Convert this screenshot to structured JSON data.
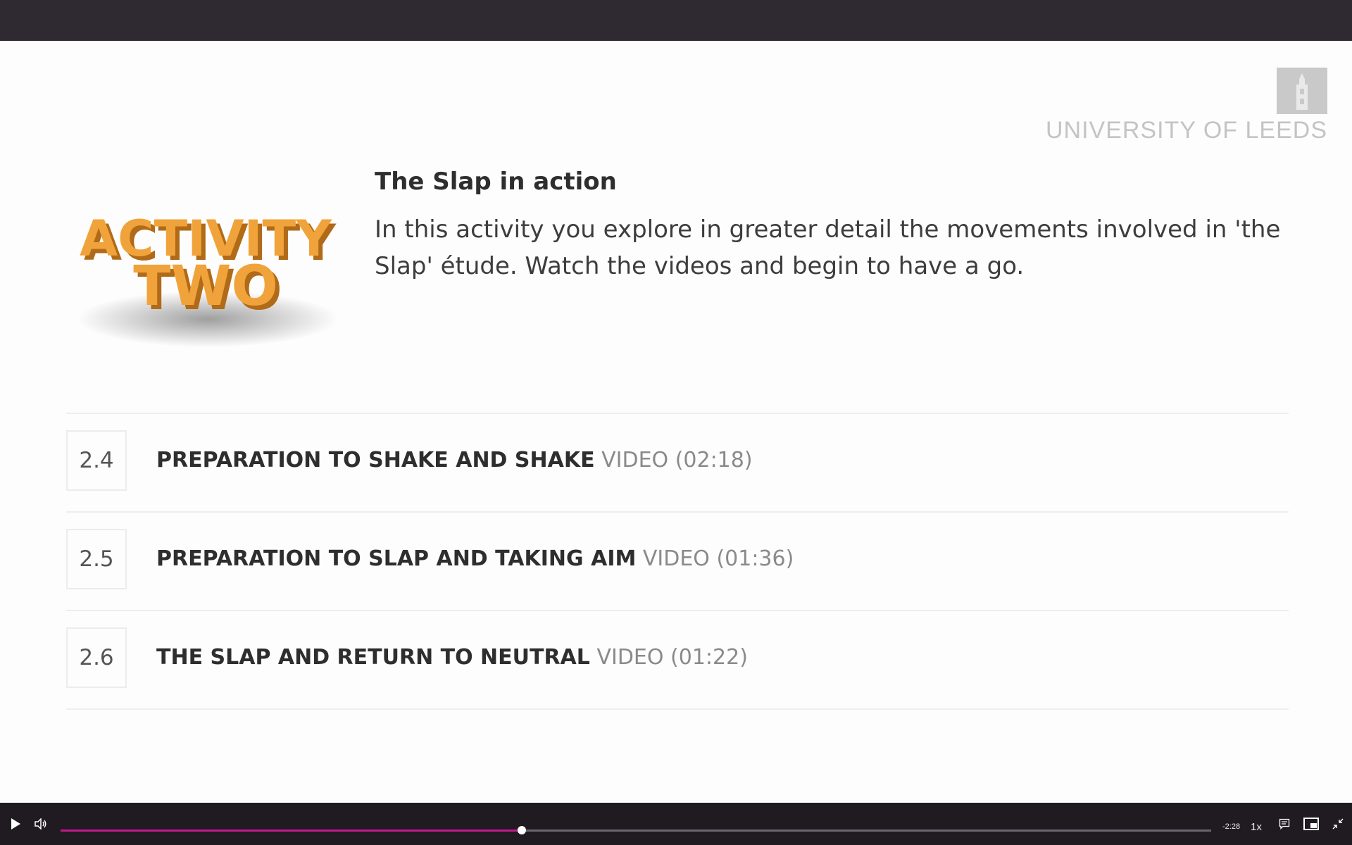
{
  "slide": {
    "branding": {
      "university_name": "UNIVERSITY OF LEEDS"
    },
    "activity_badge": {
      "line1": "ACTIVITY",
      "line2": "TWO",
      "color": "#f0a33a"
    },
    "intro": {
      "title": "The Slap in action",
      "text": "In this activity you explore in greater detail the movements involved in 'the Slap' étude. Watch the videos and begin to have a go."
    },
    "lessons": [
      {
        "number": "2.4",
        "title": "PREPARATION TO SHAKE AND SHAKE",
        "type": "VIDEO (02:18)"
      },
      {
        "number": "2.5",
        "title": "PREPARATION TO SLAP AND TAKING AIM",
        "type": "VIDEO (01:36)"
      },
      {
        "number": "2.6",
        "title": "THE SLAP AND RETURN TO NEUTRAL",
        "type": "VIDEO (01:22)"
      }
    ]
  },
  "player": {
    "progress_fraction": 0.401,
    "time_remaining": "-2:28",
    "speed": "1x",
    "accent_color": "#c2188b",
    "icons": [
      "play-icon",
      "volume-icon",
      "captions-icon",
      "picture-in-picture-icon",
      "exit-fullscreen-icon"
    ]
  }
}
